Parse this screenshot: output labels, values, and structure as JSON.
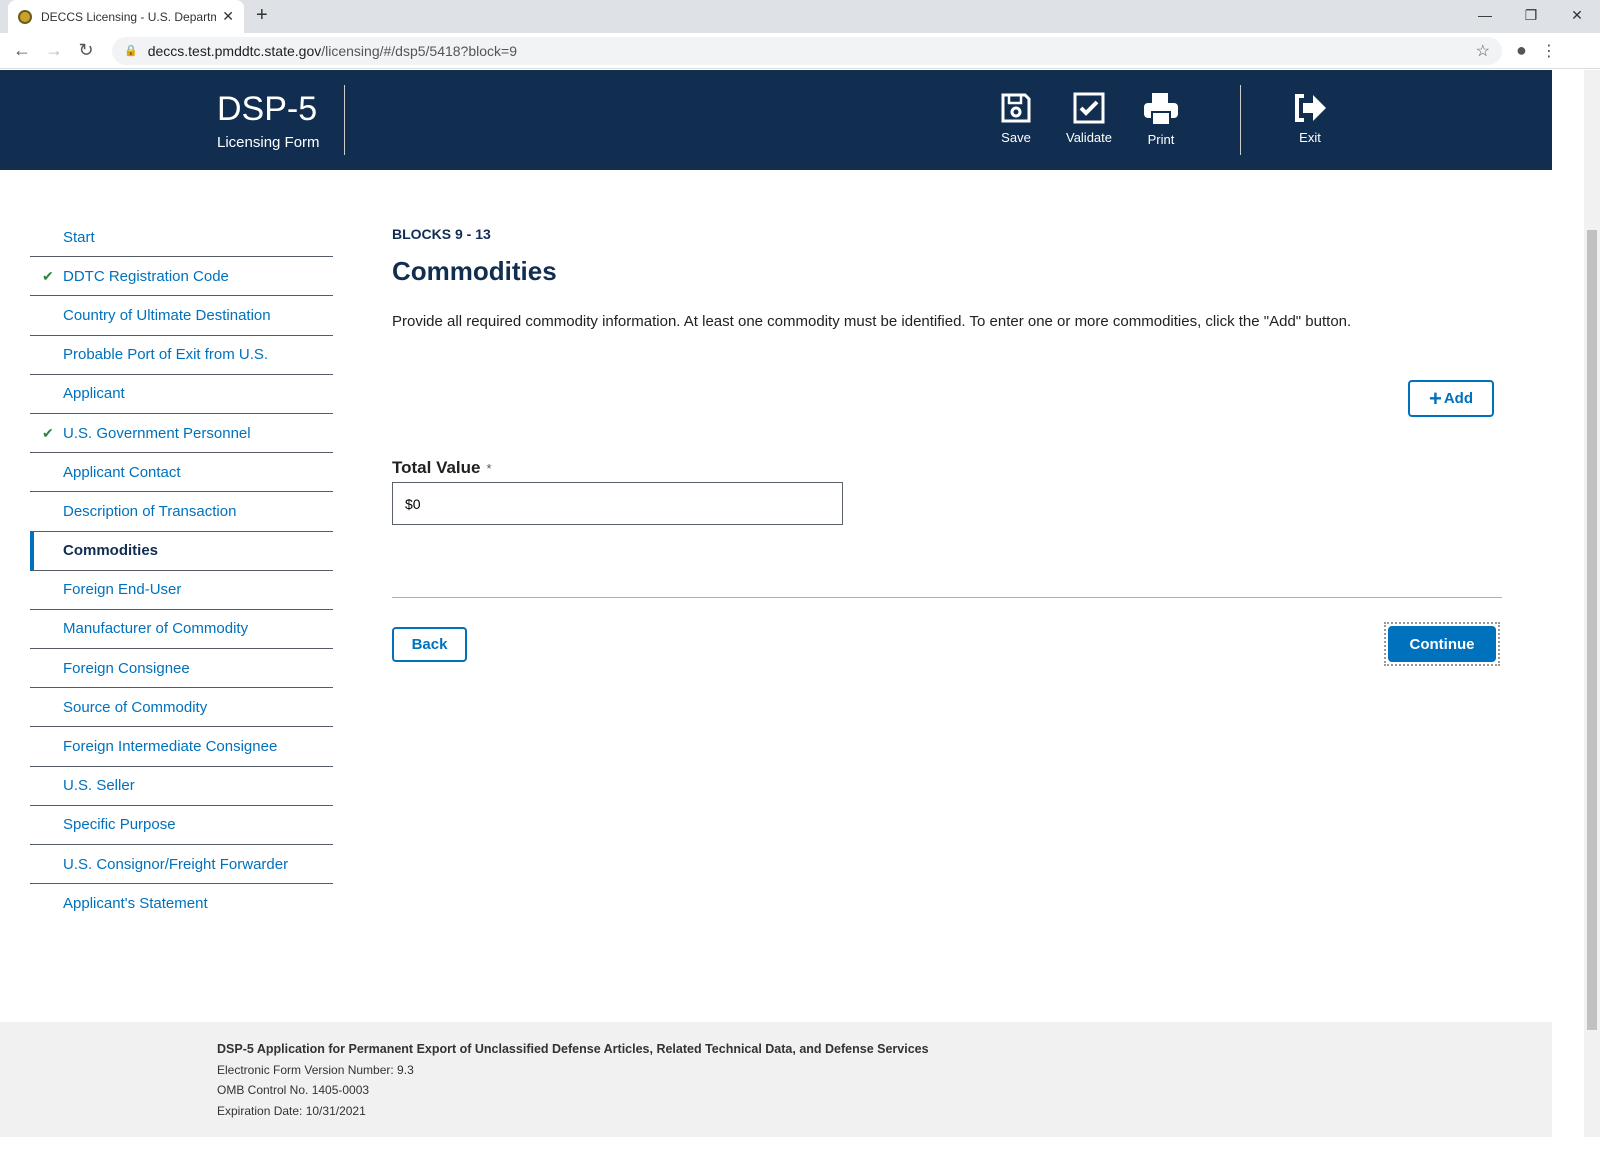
{
  "browser": {
    "tab_title": "DECCS Licensing - U.S. Departme",
    "url_host": "deccs.test.pmddtc.state.gov",
    "url_path": "/licensing/#/dsp5/5418?block=9"
  },
  "header": {
    "title": "DSP-5",
    "subtitle": "Licensing Form",
    "tools": {
      "save": "Save",
      "validate": "Validate",
      "print": "Print",
      "exit": "Exit"
    },
    "bg_color": "#112e51"
  },
  "sidebar": {
    "items": [
      {
        "label": "Start",
        "checked": false
      },
      {
        "label": "DDTC Registration Code",
        "checked": true
      },
      {
        "label": "Country of Ultimate Destination",
        "checked": false
      },
      {
        "label": "Probable Port of Exit from U.S.",
        "checked": false
      },
      {
        "label": "Applicant",
        "checked": false
      },
      {
        "label": "U.S. Government Personnel",
        "checked": true
      },
      {
        "label": "Applicant Contact",
        "checked": false
      },
      {
        "label": "Description of Transaction",
        "checked": false
      },
      {
        "label": "Commodities",
        "checked": false,
        "active": true
      },
      {
        "label": "Foreign End-User",
        "checked": false
      },
      {
        "label": "Manufacturer of Commodity",
        "checked": false
      },
      {
        "label": "Foreign Consignee",
        "checked": false
      },
      {
        "label": "Source of Commodity",
        "checked": false
      },
      {
        "label": "Foreign Intermediate Consignee",
        "checked": false
      },
      {
        "label": "U.S. Seller",
        "checked": false
      },
      {
        "label": "Specific Purpose",
        "checked": false
      },
      {
        "label": "U.S. Consignor/Freight Forwarder",
        "checked": false
      },
      {
        "label": "Applicant's Statement",
        "checked": false
      }
    ]
  },
  "main": {
    "eyebrow": "BLOCKS 9 - 13",
    "title": "Commodities",
    "description": "Provide all required commodity information. At least one commodity must be identified. To enter one or more commodities, click the \"Add\" button.",
    "add_label": "Add",
    "total_value_label": "Total Value",
    "required_mark": "*",
    "total_value": "$0",
    "back_label": "Back",
    "continue_label": "Continue",
    "accent_color": "#0071bc"
  },
  "footer": {
    "title": "DSP-5 Application for Permanent Export of Unclassified Defense Articles, Related Technical Data, and Defense Services",
    "version": "Electronic Form Version Number: 9.3",
    "omb": "OMB Control No. 1405-0003",
    "expiration": "Expiration Date: 10/31/2021"
  }
}
